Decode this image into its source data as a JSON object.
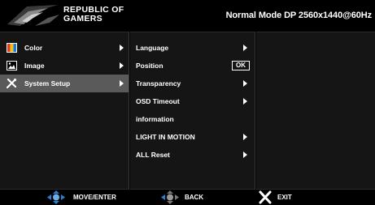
{
  "header": {
    "brand_line1": "REPUBLIC OF",
    "brand_line2": "GAMERS",
    "mode_text": "Normal Mode DP 2560x1440@60Hz"
  },
  "main_menu": {
    "items": [
      {
        "label": "Color",
        "icon": "color-palette-icon",
        "selected": false
      },
      {
        "label": "Image",
        "icon": "image-icon",
        "selected": false
      },
      {
        "label": "System Setup",
        "icon": "wrench-screwdriver-icon",
        "selected": true
      }
    ]
  },
  "submenu": {
    "items": [
      {
        "label": "Language",
        "control": "arrow"
      },
      {
        "label": "Position",
        "control": "ok",
        "ok_label": "OK"
      },
      {
        "label": "Transparency",
        "control": "arrow"
      },
      {
        "label": "OSD Timeout",
        "control": "arrow"
      },
      {
        "label": "information",
        "control": "none"
      },
      {
        "label": "LIGHT IN MOTION",
        "control": "arrow"
      },
      {
        "label": "ALL Reset",
        "control": "arrow"
      }
    ]
  },
  "footer": {
    "move_enter_label": "MOVE/ENTER",
    "back_label": "BACK",
    "exit_label": "EXIT"
  },
  "colors": {
    "background": "#000000",
    "panel": "#151515",
    "selection": "#5a5a5a",
    "accent_blue": "#2a7fd4",
    "logo_red": "#b5121b"
  }
}
